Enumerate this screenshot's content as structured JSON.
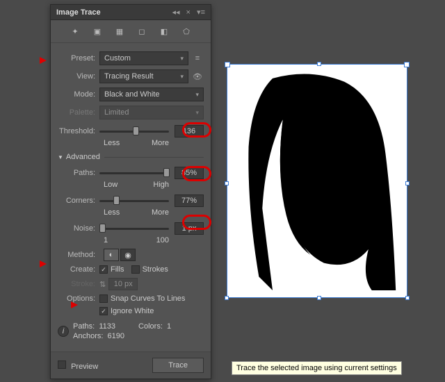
{
  "panel": {
    "title": "Image Trace"
  },
  "preset": {
    "label": "Preset:",
    "value": "Custom"
  },
  "view": {
    "label": "View:",
    "value": "Tracing Result"
  },
  "mode": {
    "label": "Mode:",
    "value": "Black and White"
  },
  "palette": {
    "label": "Palette:",
    "value": "Limited"
  },
  "threshold": {
    "label": "Threshold:",
    "value": "136",
    "min": "Less",
    "max": "More",
    "pos": 48
  },
  "advanced": {
    "label": "Advanced"
  },
  "paths": {
    "label": "Paths:",
    "value": "85%",
    "min": "Low",
    "max": "High",
    "pos": 92
  },
  "corners": {
    "label": "Corners:",
    "value": "77%",
    "min": "Less",
    "max": "More",
    "pos": 20
  },
  "noise": {
    "label": "Noise:",
    "value": "1 px",
    "min": "1",
    "max": "100",
    "pos": 0
  },
  "method": {
    "label": "Method:"
  },
  "create": {
    "label": "Create:",
    "fills": "Fills",
    "strokes": "Strokes",
    "fills_on": true,
    "strokes_on": false
  },
  "stroke": {
    "label": "Stroke:",
    "value": "10 px"
  },
  "options": {
    "label": "Options:",
    "snap": "Snap Curves To Lines",
    "ignore": "Ignore White",
    "snap_on": false,
    "ignore_on": true
  },
  "info": {
    "paths_l": "Paths:",
    "paths_v": "1133",
    "colors_l": "Colors:",
    "colors_v": "1",
    "anchors_l": "Anchors:",
    "anchors_v": "6190"
  },
  "footer": {
    "preview": "Preview",
    "trace": "Trace"
  },
  "tooltip": "Trace the selected image using current settings"
}
